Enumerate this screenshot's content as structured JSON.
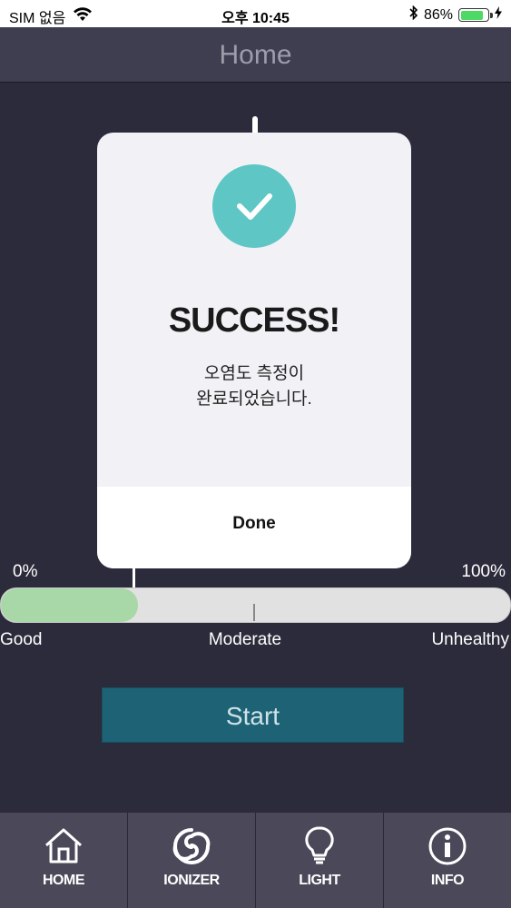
{
  "status_bar": {
    "carrier": "SIM 없음",
    "time": "오후 10:45",
    "battery_percent": "86%",
    "battery_level": 0.86
  },
  "header": {
    "title": "Home"
  },
  "gauge": {
    "min_label": "0%",
    "max_label": "100%",
    "fill_fraction": 0.27,
    "level_good": "Good",
    "level_moderate": "Moderate",
    "level_unhealthy": "Unhealthy",
    "fill_color": "#a8d8a8"
  },
  "start_button": {
    "label": "Start"
  },
  "tabs": [
    {
      "label": "HOME",
      "icon": "home-icon"
    },
    {
      "label": "IONIZER",
      "icon": "ionizer-icon"
    },
    {
      "label": "LIGHT",
      "icon": "lightbulb-icon"
    },
    {
      "label": "INFO",
      "icon": "info-icon"
    }
  ],
  "dialog": {
    "title": "SUCCESS!",
    "message_line1": "오염도 측정이",
    "message_line2": "완료되었습니다.",
    "done_label": "Done",
    "accent_color": "#5ec6c4"
  }
}
